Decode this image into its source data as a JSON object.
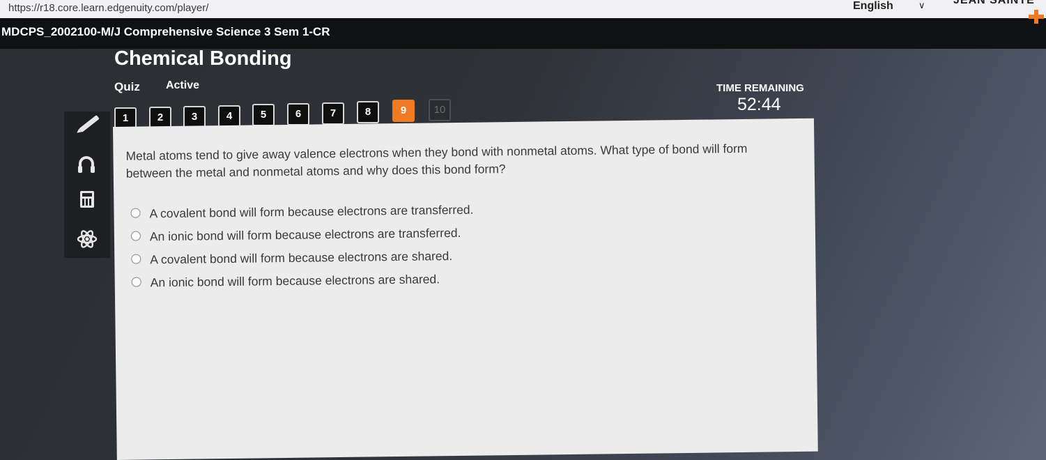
{
  "browser": {
    "url": "https://r18.core.learn.edgenuity.com/player/",
    "language": "English",
    "user": "JEAN SAINTE"
  },
  "course": {
    "title": "MDCPS_2002100-M/J Comprehensive Science 3 Sem 1-CR"
  },
  "lesson": {
    "title": "Chemical Bonding",
    "type": "Quiz",
    "status": "Active"
  },
  "timer": {
    "label": "TIME REMAINING",
    "value": "52:44"
  },
  "question_nav": {
    "items": [
      "1",
      "2",
      "3",
      "4",
      "5",
      "6",
      "7",
      "8",
      "9",
      "10"
    ],
    "current": "9",
    "disabled": [
      "10"
    ]
  },
  "tools": [
    "pencil-icon",
    "headphones-icon",
    "calculator-icon",
    "atom-icon"
  ],
  "question": {
    "text": "Metal atoms tend to give away valence electrons when they bond with nonmetal atoms. What type of bond will form between the metal and nonmetal atoms and why does this bond form?",
    "options": [
      "A covalent bond will form because electrons are transferred.",
      "An ionic bond will form because electrons are transferred.",
      "A covalent bond will form because electrons are shared.",
      "An ionic bond will form because electrons are shared."
    ]
  },
  "colors": {
    "accent": "#f07a22",
    "course_bar": "#101112",
    "panel": "#ececec",
    "text": "#3a3a3a"
  }
}
